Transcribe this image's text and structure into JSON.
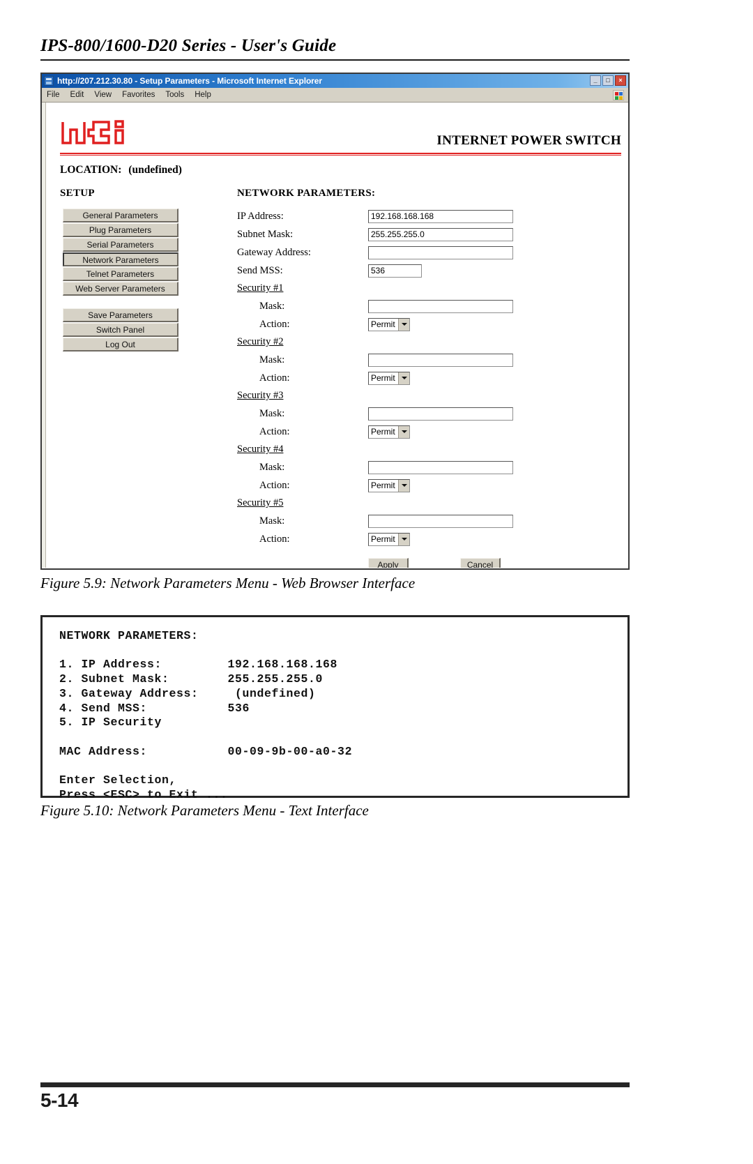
{
  "page": {
    "header_title": "IPS-800/1600-D20 Series - User's Guide",
    "page_number": "5-14"
  },
  "browser": {
    "title": "http://207.212.30.80 - Setup Parameters - Microsoft Internet Explorer",
    "doc_icon": "ie-document-icon",
    "window_buttons": [
      {
        "name": "minimize-button",
        "glyph": "_"
      },
      {
        "name": "maximize-button",
        "glyph": "□"
      },
      {
        "name": "close-button",
        "glyph": "×"
      }
    ],
    "menu_items": [
      "File",
      "Edit",
      "View",
      "Favorites",
      "Tools",
      "Help"
    ],
    "menu_logo": "windows-flag-icon"
  },
  "webpage": {
    "logo_text": "wti",
    "logo_color": "#e02020",
    "product_title": "INTERNET POWER SWITCH",
    "location_label": "LOCATION:",
    "location_value": "(undefined)",
    "setup_heading": "SETUP",
    "nav_primary": [
      {
        "label": "General Parameters",
        "selected": false
      },
      {
        "label": "Plug Parameters",
        "selected": false
      },
      {
        "label": "Serial Parameters",
        "selected": false
      },
      {
        "label": "Network Parameters",
        "selected": true
      },
      {
        "label": "Telnet Parameters",
        "selected": false
      },
      {
        "label": "Web Server Parameters",
        "selected": false
      }
    ],
    "nav_secondary": [
      {
        "label": "Save Parameters",
        "selected": false
      },
      {
        "label": "Switch Panel",
        "selected": false
      },
      {
        "label": "Log Out",
        "selected": false
      }
    ],
    "form": {
      "title": "NETWORK PARAMETERS:",
      "fields": [
        {
          "label": "IP Address:",
          "value": "192.168.168.168",
          "size": "wide"
        },
        {
          "label": "Subnet Mask:",
          "value": "255.255.255.0",
          "size": "wide"
        },
        {
          "label": "Gateway Address:",
          "value": "",
          "size": "wide"
        },
        {
          "label": "Send MSS:",
          "value": "536",
          "size": "narrow"
        }
      ],
      "security_sections": [
        {
          "heading": "Security #1",
          "mask_label": "Mask:",
          "mask_value": "",
          "action_label": "Action:",
          "action_value": "Permit"
        },
        {
          "heading": "Security #2",
          "mask_label": "Mask:",
          "mask_value": "",
          "action_label": "Action:",
          "action_value": "Permit"
        },
        {
          "heading": "Security #3",
          "mask_label": "Mask:",
          "mask_value": "",
          "action_label": "Action:",
          "action_value": "Permit"
        },
        {
          "heading": "Security #4",
          "mask_label": "Mask:",
          "mask_value": "",
          "action_label": "Action:",
          "action_value": "Permit"
        },
        {
          "heading": "Security #5",
          "mask_label": "Mask:",
          "mask_value": "",
          "action_label": "Action:",
          "action_value": "Permit"
        }
      ],
      "apply_label": "Apply",
      "cancel_label": "Cancel"
    }
  },
  "captions": {
    "figure_59": "Figure 5.9:  Network Parameters Menu - Web Browser Interface",
    "figure_510": "Figure 5.10:  Network Parameters Menu - Text Interface"
  },
  "text_interface": {
    "lines": [
      "NETWORK PARAMETERS:",
      "",
      "1. IP Address:         192.168.168.168",
      "2. Subnet Mask:        255.255.255.0",
      "3. Gateway Address:     (undefined)",
      "4. Send MSS:           536",
      "5. IP Security",
      "",
      "MAC Address:           00-09-9b-00-a0-32",
      "",
      "Enter Selection,",
      "Press <ESC> to Exit ..."
    ]
  }
}
